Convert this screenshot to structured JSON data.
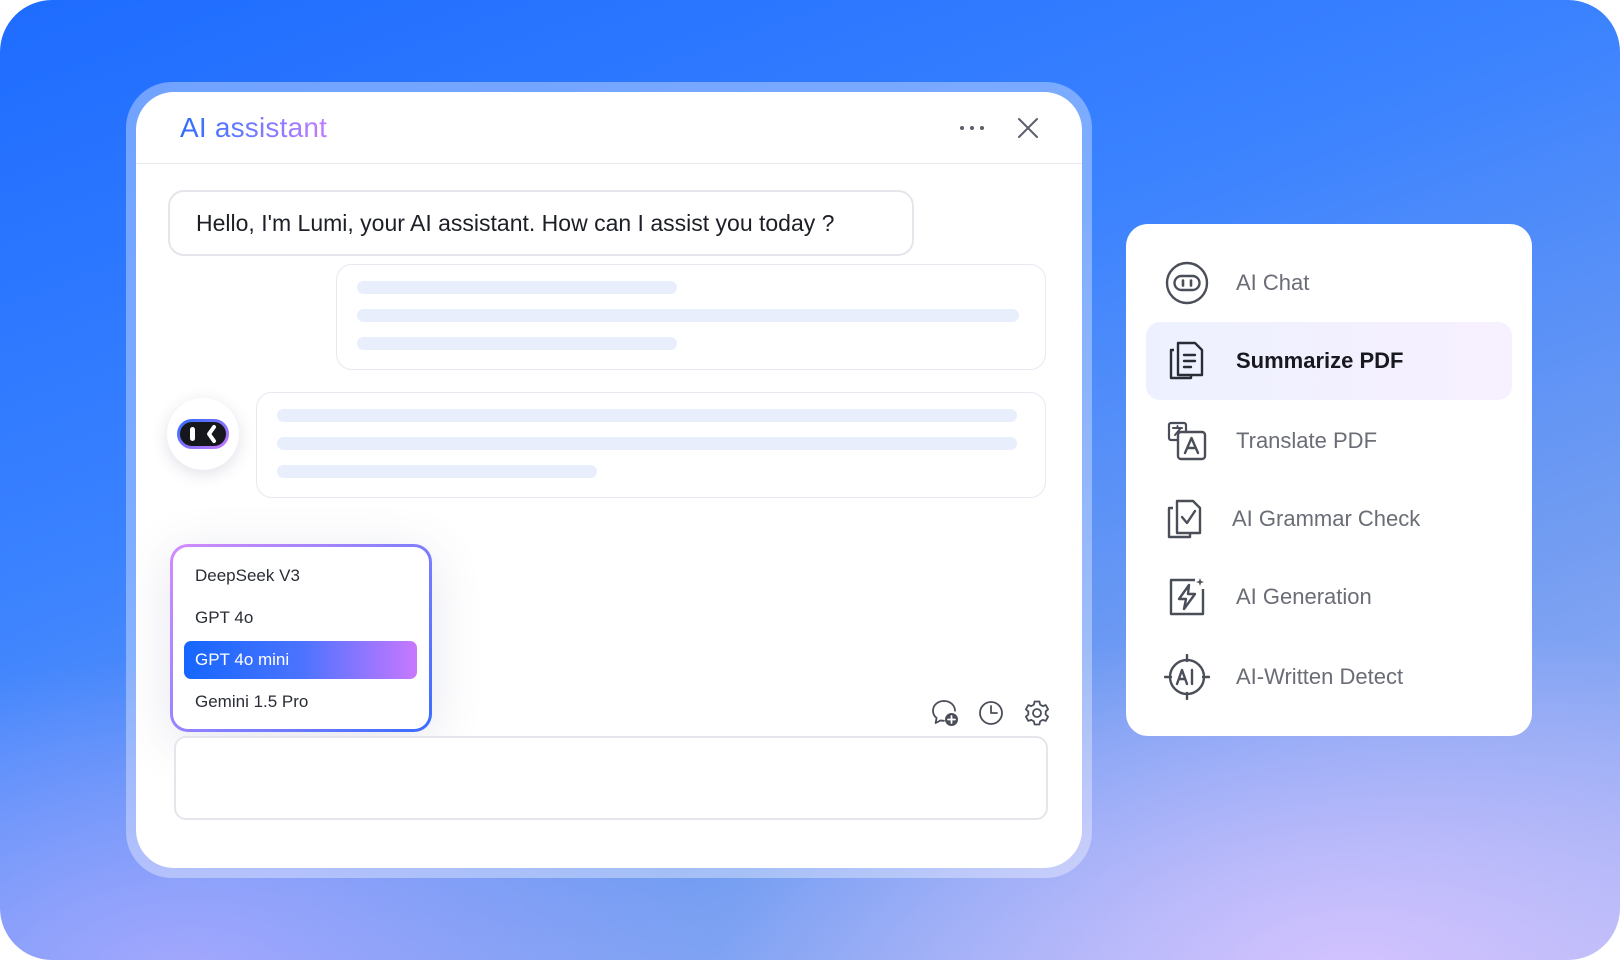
{
  "assistant": {
    "title": "AI assistant",
    "greeting": "Hello, I'm Lumi, your AI assistant. How can I assist you today ?"
  },
  "model_menu": {
    "items": [
      {
        "label": "DeepSeek V3"
      },
      {
        "label": "GPT 4o"
      },
      {
        "label": "GPT 4o mini"
      },
      {
        "label": "Gemini 1.5 Pro"
      }
    ],
    "selected": "GPT 4o mini"
  },
  "toolbar": {
    "icons": [
      "new-chat-icon",
      "history-icon",
      "settings-icon"
    ]
  },
  "features": {
    "items": [
      {
        "label": "AI Chat",
        "icon": "robot-chat-icon"
      },
      {
        "label": "Summarize PDF",
        "icon": "summarize-document-icon"
      },
      {
        "label": "Translate PDF",
        "icon": "translate-icon"
      },
      {
        "label": "AI Grammar Check",
        "icon": "grammar-check-icon"
      },
      {
        "label": "AI Generation",
        "icon": "lightning-generate-icon"
      },
      {
        "label": "AI-Written Detect",
        "icon": "ai-detect-icon"
      }
    ],
    "active": "Summarize PDF"
  },
  "colors": {
    "accent_blue": "#1566ff",
    "accent_purple": "#c878ff",
    "skeleton": "#e8eefb"
  }
}
